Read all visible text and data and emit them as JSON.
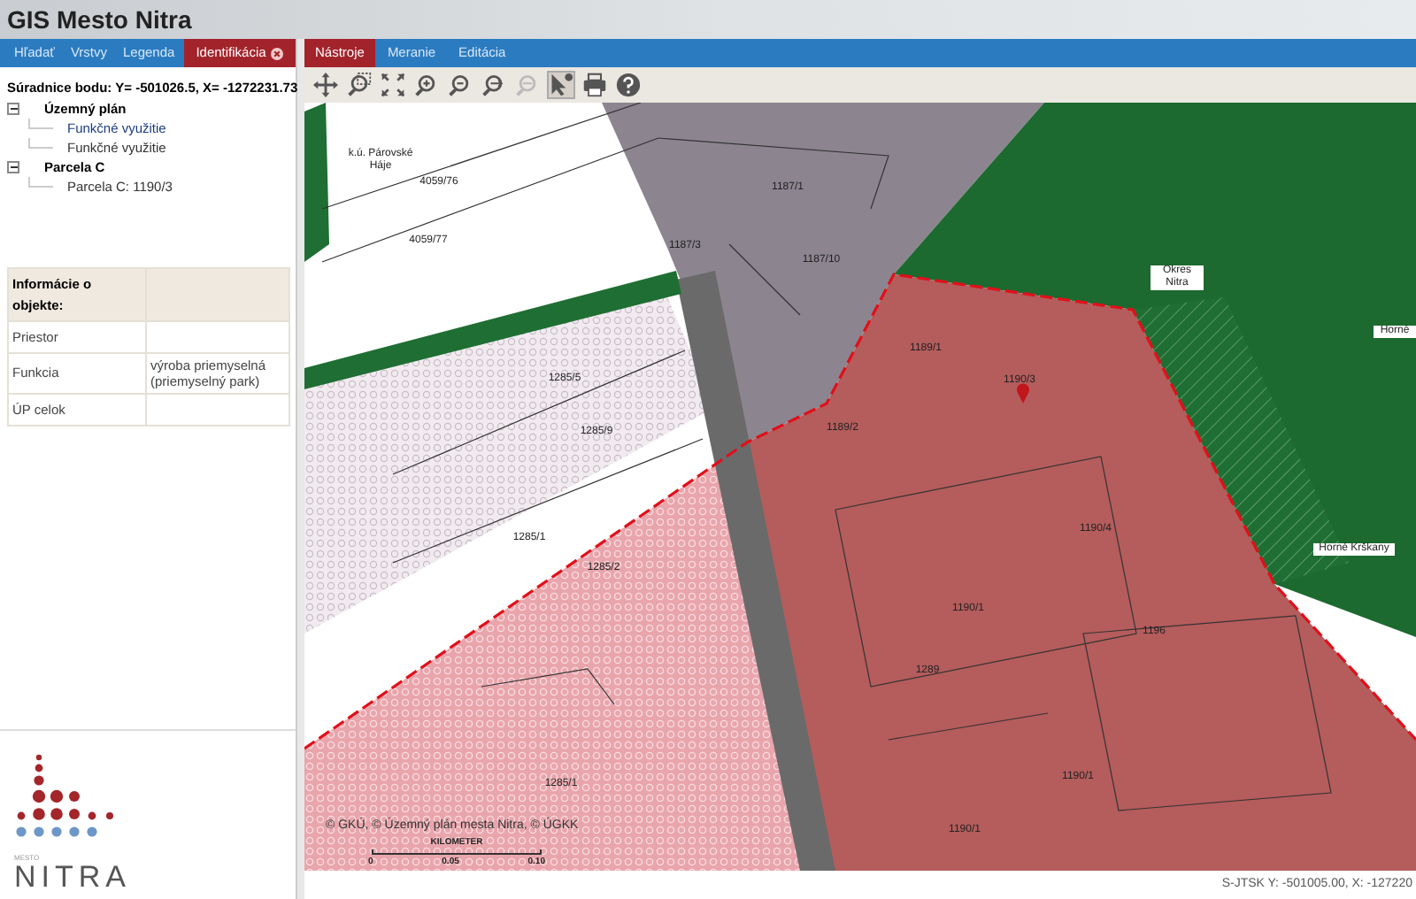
{
  "window": {
    "title": "GIS Mesto Nitra"
  },
  "left_tabs": [
    {
      "label": "Hľadať",
      "selected": false,
      "closable": false
    },
    {
      "label": "Vrstvy",
      "selected": false,
      "closable": false
    },
    {
      "label": "Legenda",
      "selected": false,
      "closable": false
    },
    {
      "label": "Identifikácia",
      "selected": true,
      "closable": true
    }
  ],
  "right_tabs": [
    {
      "label": "Nástroje",
      "selected": true
    },
    {
      "label": "Meranie",
      "selected": false
    },
    {
      "label": "Editácia",
      "selected": false
    }
  ],
  "identify": {
    "coordinates": "Súradnice bodu: Y= -501026.5, X= -1272231.73",
    "tree": [
      {
        "label": "Územný plán",
        "expanded": true,
        "children": [
          {
            "label": "Funkčné využitie",
            "selected": true
          },
          {
            "label": "Funkčné využitie",
            "selected": false
          }
        ]
      },
      {
        "label": "Parcela C",
        "expanded": true,
        "children": [
          {
            "label": "Parcela C: 1190/3",
            "selected": false
          }
        ]
      }
    ]
  },
  "info_table": {
    "title": "Informácie o objekte:",
    "rows": [
      {
        "label": "Priestor",
        "value": ""
      },
      {
        "label": "Funkcia",
        "value": "výroba priemyselná (priemyselný park)"
      },
      {
        "label": "ÚP celok",
        "value": ""
      }
    ]
  },
  "logo": {
    "small": "MESTO",
    "name": "NITRA"
  },
  "toolbar": [
    {
      "kind": "pan",
      "selected": false,
      "disabled": false
    },
    {
      "kind": "zoombox",
      "selected": false,
      "disabled": false
    },
    {
      "kind": "extent",
      "selected": false,
      "disabled": false
    },
    {
      "kind": "zoomin",
      "selected": false,
      "disabled": false
    },
    {
      "kind": "zoomout",
      "selected": false,
      "disabled": false
    },
    {
      "kind": "previous",
      "selected": false,
      "disabled": false
    },
    {
      "kind": "next",
      "selected": false,
      "disabled": true
    },
    {
      "kind": "identify",
      "selected": true,
      "disabled": false
    },
    {
      "kind": "print",
      "selected": false,
      "disabled": false
    },
    {
      "kind": "help",
      "selected": false,
      "disabled": false
    }
  ],
  "map": {
    "labels": [
      "k.ú. Párovské Háje",
      "4059/76",
      "4059/77",
      "1187/1",
      "1187/3",
      "1187/10",
      "1189/1",
      "1190/3",
      "1189/2",
      "1190/4",
      "1285/5",
      "1285/9",
      "1285/1",
      "1285/2",
      "1196",
      "1190/1",
      "1289",
      "1285/1",
      "Okres Nitra",
      "Horné Krškany",
      "Horné",
      "1190/1",
      "1190/1"
    ],
    "attribution": "© GKÚ, © Územný plán mesta Nitra, © ÚGKK",
    "scale": {
      "unit": "KILOMETER",
      "ticks": [
        "0",
        "0.05",
        "0.10"
      ]
    }
  },
  "status_bar": "S-JTSK Y: -501005.00, X: -127220"
}
